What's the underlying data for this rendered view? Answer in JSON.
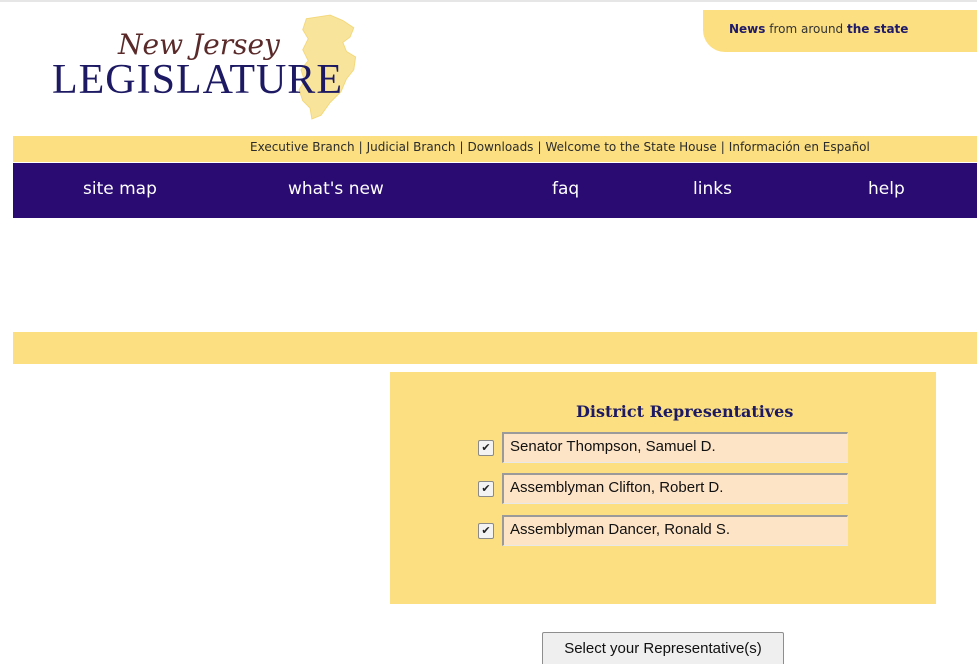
{
  "logo": {
    "script_text": "New Jersey",
    "main_text": "LEGISLATURE"
  },
  "news_tab": {
    "part1": "News",
    "part2": " from around ",
    "part3": "the state"
  },
  "top_links": [
    "Executive Branch",
    "Judicial Branch",
    "Downloads",
    "Welcome to the State House",
    "Información en Español"
  ],
  "top_links_separator": "|",
  "nav": {
    "items": [
      "site map",
      "what's new",
      "faq",
      "links",
      "help"
    ]
  },
  "representatives": {
    "title": "District Representatives",
    "items": [
      {
        "name": "Senator Thompson, Samuel D.",
        "checked": true
      },
      {
        "name": "Assemblyman Clifton, Robert D.",
        "checked": true
      },
      {
        "name": "Assemblyman Dancer, Ronald S.",
        "checked": true
      }
    ],
    "check_glyph": "✔"
  },
  "button": {
    "label": "Select your Representative(s)"
  },
  "colors": {
    "banner_yellow": "#fbdf80",
    "nav_purple": "#2a0b72",
    "logo_navy": "#1d1a63",
    "field_peach": "#fde4c6"
  }
}
